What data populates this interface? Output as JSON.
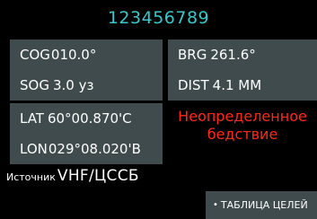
{
  "header": {
    "mmsi": "123456789"
  },
  "cog_panel": {
    "cog_label": "COG",
    "cog_value": "010.0°",
    "sog_label": "SOG",
    "sog_value": "3.0 уз"
  },
  "brg_panel": {
    "brg_label": "BRG",
    "brg_value": "261.6°",
    "dist_label": "DIST",
    "dist_value": "4.1 ММ"
  },
  "pos_panel": {
    "lat_label": "LAT",
    "lat_value": "60°00.870'С",
    "lon_label": "LON",
    "lon_value": "029°08.020'В"
  },
  "distress": {
    "text": "Неопределенное бедствие"
  },
  "source": {
    "label": "Источник",
    "value": "VHF/ЦССБ"
  },
  "targets_button": {
    "bullet": "•",
    "label": "ТАБЛИЦА ЦЕЛЕЙ"
  },
  "colors": {
    "accent": "#3ec6c9",
    "alert": "#ff2a1a",
    "panel": "#3f4b4c",
    "background": "#000000"
  }
}
